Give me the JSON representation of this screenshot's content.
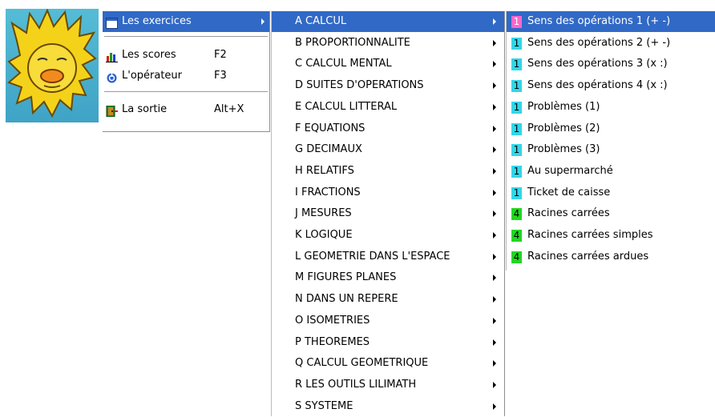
{
  "main_menu": {
    "items": [
      {
        "label": "Les exercices",
        "key": "",
        "icon": "window-icon",
        "arrow": true
      },
      {
        "label": "Les scores",
        "key": "F2",
        "icon": "bar-chart-icon",
        "arrow": false
      },
      {
        "label": "L'opérateur",
        "key": "F3",
        "icon": "power-icon",
        "arrow": false
      },
      {
        "label": "La sortie",
        "key": "Alt+X",
        "icon": "exit-door-icon",
        "arrow": false
      }
    ]
  },
  "sub_menu": {
    "items": [
      "A CALCUL",
      "B PROPORTIONNALITE",
      "C CALCUL MENTAL",
      "D SUITES D'OPERATIONS",
      "E CALCUL LITTERAL",
      "F EQUATIONS",
      "G DECIMAUX",
      "H RELATIFS",
      "I FRACTIONS",
      "J MESURES",
      "K LOGIQUE",
      "L GEOMETRIE DANS L'ESPACE",
      "M FIGURES PLANES",
      "N DANS UN REPERE",
      "O ISOMETRIES",
      "P THEOREMES",
      "Q CALCUL GEOMETRIQUE",
      "R LES OUTILS LILIMATH",
      "S SYSTEME"
    ]
  },
  "exercise_menu": {
    "items": [
      {
        "level": "1",
        "label": "Sens des opérations 1 (+ -)",
        "color": "#ff66cc"
      },
      {
        "level": "1",
        "label": "Sens des opérations 2 (+ -)",
        "color": "#33d6e8"
      },
      {
        "level": "1",
        "label": "Sens des opérations 3 (x :)",
        "color": "#33d6e8"
      },
      {
        "level": "1",
        "label": "Sens des opérations 4 (x :)",
        "color": "#33d6e8"
      },
      {
        "level": "1",
        "label": "Problèmes (1)",
        "color": "#33d6e8"
      },
      {
        "level": "1",
        "label": "Problèmes (2)",
        "color": "#33d6e8"
      },
      {
        "level": "1",
        "label": "Problèmes (3)",
        "color": "#33d6e8"
      },
      {
        "level": "1",
        "label": "Au supermarché",
        "color": "#33d6e8"
      },
      {
        "level": "1",
        "label": "Ticket de caisse",
        "color": "#33d6e8"
      },
      {
        "level": "4",
        "label": "Racines carrées",
        "color": "#22d722"
      },
      {
        "level": "4",
        "label": "Racines carrées simples",
        "color": "#22d722"
      },
      {
        "level": "4",
        "label": "Racines carrées ardues",
        "color": "#22d722"
      }
    ]
  },
  "colors": {
    "selection": "#3169c6",
    "logo_background": "#4fb4d2"
  }
}
